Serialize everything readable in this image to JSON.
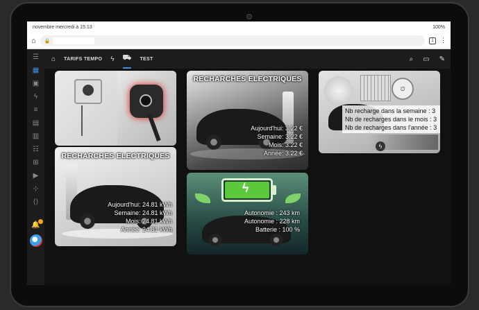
{
  "status": {
    "time": "novembre mercredi à 15:13",
    "battery": "100%"
  },
  "browser": {
    "tabs_count": "1"
  },
  "topbar": {
    "tabs": [
      {
        "label": "TARIFS TEMPO"
      },
      {
        "label": "TEST"
      }
    ]
  },
  "cards": {
    "energy": {
      "title": "RECHARCHES ELECTRIQUES",
      "today": "Aujourd'hui: 24.81 kWh",
      "week": "Semaine: 24.81 kWh",
      "month": "Mois: 24.81 kWh",
      "year": "Année: 24.81 kWh"
    },
    "cost": {
      "title": "RECHARCHES ELECTRIQUES",
      "today": "Aujourd'hui: 3.22 €",
      "week": "Semaine: 3.22 €",
      "month": "Mois: 3.22 €",
      "year": "Année: 3.22 €"
    },
    "range": {
      "range1": "Autonomie : 243 km",
      "range2": "Autonomie : 228 km",
      "battery": "Batterie : 100 %",
      "battery_level": 1.0
    },
    "counts": {
      "week": "Nb recharge dans la semaine : 3",
      "month": "Nb de recharges dans le mois : 3",
      "year": "Nb de recharges dans l'année : 3"
    }
  },
  "colors": {
    "accent": "#3b8ee8",
    "badge": "#f5a623",
    "battery_green": "#5cc83c"
  }
}
